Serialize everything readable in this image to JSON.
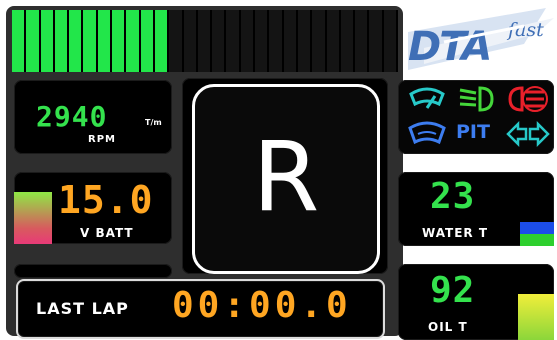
{
  "shift_light": {
    "lit_segments": 11,
    "total_segments": 27
  },
  "rpm": {
    "value": "2940",
    "unit": "T/m",
    "label": "RPM"
  },
  "gear": {
    "value": "R"
  },
  "battery": {
    "value": "15.0",
    "label": "V BATT"
  },
  "last_lap": {
    "label": "LAST LAP",
    "value": "00:00.0"
  },
  "indicators": {
    "pit": "PIT",
    "icons": [
      "wiper-icon",
      "headlight-icon",
      "fog-light-icon",
      "washer-icon",
      "turn-signal-icon"
    ]
  },
  "water": {
    "value": "23",
    "label": "WATER T"
  },
  "oil": {
    "value": "92",
    "label": "OIL T"
  },
  "logo": {
    "brand": "DTA",
    "tagline": "fast"
  },
  "colors": {
    "green": "#34e24d",
    "orange": "#ffa622",
    "blue": "#3d7df0",
    "red": "#e8202a"
  }
}
